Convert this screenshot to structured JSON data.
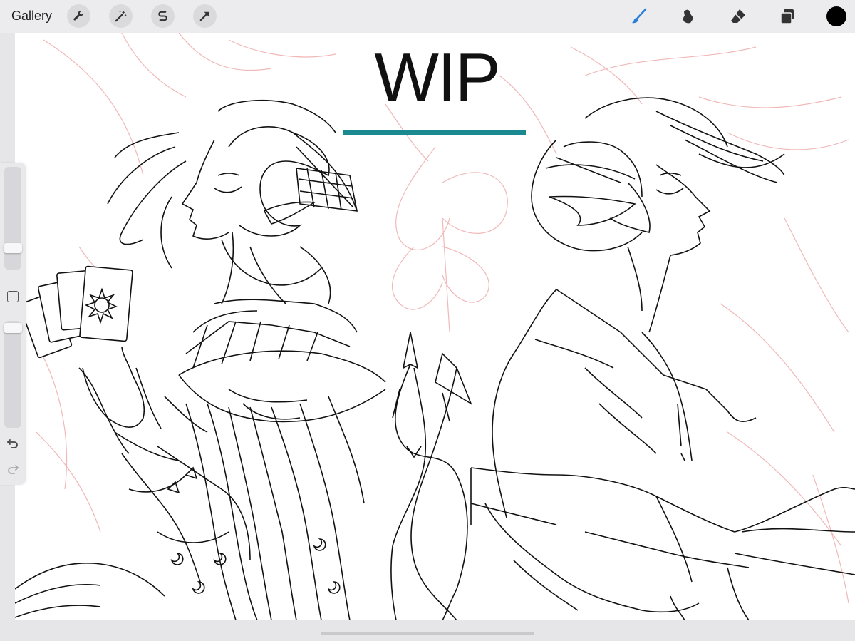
{
  "toolbar": {
    "gallery_label": "Gallery",
    "left_tools": [
      {
        "name": "actions",
        "icon": "wrench-icon"
      },
      {
        "name": "adjustments",
        "icon": "magic-wand-icon"
      },
      {
        "name": "selection",
        "icon": "selection-s-icon"
      },
      {
        "name": "transform",
        "icon": "arrow-icon"
      }
    ],
    "right_tools": [
      {
        "name": "brush",
        "icon": "brush-icon",
        "active": true
      },
      {
        "name": "smudge",
        "icon": "smudge-icon",
        "active": false
      },
      {
        "name": "eraser",
        "icon": "eraser-icon",
        "active": false
      },
      {
        "name": "layers",
        "icon": "layers-icon",
        "active": false
      }
    ],
    "current_color": "#000000",
    "active_color": "#2b7fd9"
  },
  "canvas": {
    "title_text": "WIP",
    "underline_color": "#1a8a90",
    "sketch_color": "#f0b8b8",
    "ink_color": "#111111"
  },
  "sidebar": {
    "brush_size_level": 0.78,
    "opacity_level": 0.1,
    "icons": [
      "modify-icon",
      "undo-icon",
      "redo-icon"
    ]
  }
}
